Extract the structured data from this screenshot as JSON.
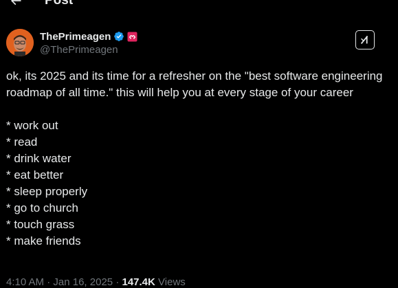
{
  "header": {
    "title": "Post",
    "back_icon": "arrow-left-icon"
  },
  "author": {
    "display_name": "ThePrimeagen",
    "handle": "@ThePrimeagen",
    "verified_icon": "verified-badge-icon",
    "affiliate_icon": "affiliate-badge-icon",
    "verified_color": "#1d9bf0",
    "affiliate_color": "#e0245e"
  },
  "grok": {
    "icon": "grok-icon"
  },
  "post": {
    "intro": "ok, its 2025 and its time for a refresher on the \"best software engineering roadmap of all time.\"  this will help you at every stage of your career",
    "items": [
      "* work out",
      "* read",
      "* drink water",
      "* eat better",
      "* sleep properly",
      "* go to church",
      "* touch grass",
      "* make friends"
    ]
  },
  "meta": {
    "time": "4:10 AM",
    "separator": "·",
    "date": "Jan 16, 2025",
    "views_count": "147.4K",
    "views_label": "Views"
  },
  "colors": {
    "background": "#000000",
    "text": "#e7e9ea",
    "muted": "#71767b"
  }
}
